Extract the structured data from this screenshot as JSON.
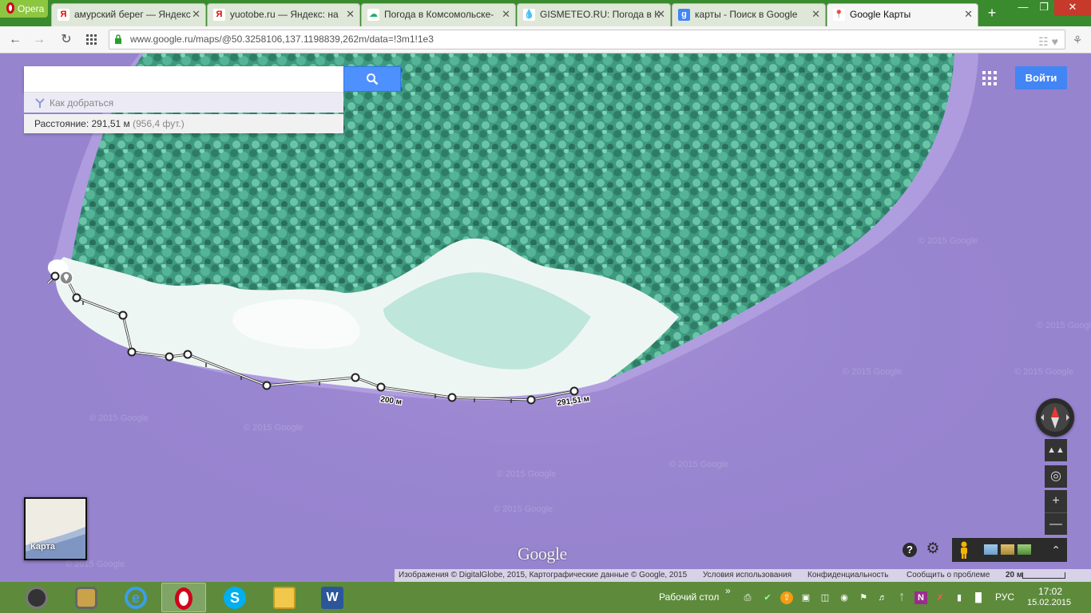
{
  "browser": {
    "opera_label": "Opera",
    "tabs": [
      {
        "title": "амурский берег — Яндекс",
        "favicon": "Я"
      },
      {
        "title": "yuotobe.ru — Яндекс: на",
        "favicon": "Я"
      },
      {
        "title": "Погода в Комсомольске-",
        "favicon": "☁"
      },
      {
        "title": "GISMETEO.RU: Погода в К",
        "favicon": "💧"
      },
      {
        "title": "карты - Поиск в Google",
        "favicon": "g"
      },
      {
        "title": "Google Карты",
        "favicon": "📍"
      }
    ],
    "active_tab": 5,
    "close_glyph": "✕",
    "new_tab_glyph": "+",
    "url": "www.google.ru/maps/@50.3258106,137.1198839,262m/data=!3m1!1e3"
  },
  "search": {
    "placeholder": "",
    "directions_label": "Как добраться",
    "distance_label": "Расстояние: 291,51 м",
    "distance_alt": "(956,4 фут.)"
  },
  "header": {
    "signin_label": "Войти"
  },
  "measurement": {
    "label_mid": "200 м",
    "label_end": "291,51 м"
  },
  "watermark": "© 2015 Google",
  "map_controls": {
    "help_glyph": "?",
    "settings_glyph": "⚙",
    "expand_glyph": "⌃",
    "thumbnail_label": "Карта"
  },
  "google_logo": "Google",
  "attribution": {
    "imagery": "Изображения © DigitalGlobe, 2015, Картографические данные © Google, 2015",
    "terms": "Условия использования",
    "privacy": "Конфиденциальность",
    "report": "Сообщить о проблеме",
    "scale": "20 м"
  },
  "taskbar": {
    "desktop_label": "Рабочий стол",
    "lang": "РУС",
    "time": "17:02",
    "date": "15.02.2015"
  },
  "colors": {
    "water": "#9784cf",
    "forest": "#3e9a7e",
    "beach": "#eef6f3",
    "accent_blue": "#4285f4",
    "taskbar": "#5d8b3b"
  }
}
